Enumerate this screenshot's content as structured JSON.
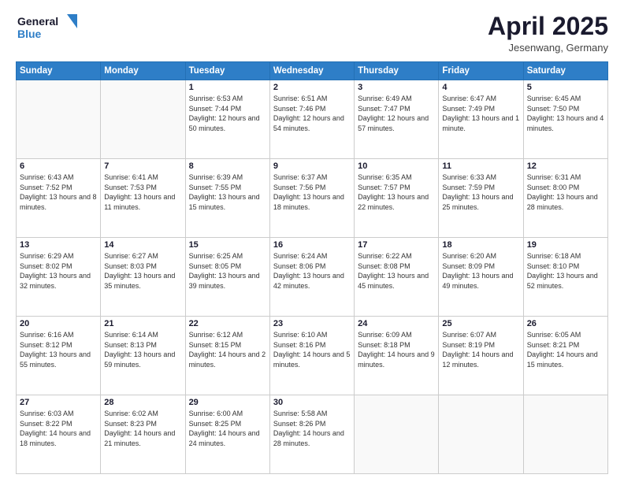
{
  "logo": {
    "line1": "General",
    "line2": "Blue"
  },
  "header": {
    "month": "April 2025",
    "location": "Jesenwang, Germany"
  },
  "weekdays": [
    "Sunday",
    "Monday",
    "Tuesday",
    "Wednesday",
    "Thursday",
    "Friday",
    "Saturday"
  ],
  "weeks": [
    [
      {
        "day": "",
        "info": ""
      },
      {
        "day": "",
        "info": ""
      },
      {
        "day": "1",
        "info": "Sunrise: 6:53 AM\nSunset: 7:44 PM\nDaylight: 12 hours and 50 minutes."
      },
      {
        "day": "2",
        "info": "Sunrise: 6:51 AM\nSunset: 7:46 PM\nDaylight: 12 hours and 54 minutes."
      },
      {
        "day": "3",
        "info": "Sunrise: 6:49 AM\nSunset: 7:47 PM\nDaylight: 12 hours and 57 minutes."
      },
      {
        "day": "4",
        "info": "Sunrise: 6:47 AM\nSunset: 7:49 PM\nDaylight: 13 hours and 1 minute."
      },
      {
        "day": "5",
        "info": "Sunrise: 6:45 AM\nSunset: 7:50 PM\nDaylight: 13 hours and 4 minutes."
      }
    ],
    [
      {
        "day": "6",
        "info": "Sunrise: 6:43 AM\nSunset: 7:52 PM\nDaylight: 13 hours and 8 minutes."
      },
      {
        "day": "7",
        "info": "Sunrise: 6:41 AM\nSunset: 7:53 PM\nDaylight: 13 hours and 11 minutes."
      },
      {
        "day": "8",
        "info": "Sunrise: 6:39 AM\nSunset: 7:55 PM\nDaylight: 13 hours and 15 minutes."
      },
      {
        "day": "9",
        "info": "Sunrise: 6:37 AM\nSunset: 7:56 PM\nDaylight: 13 hours and 18 minutes."
      },
      {
        "day": "10",
        "info": "Sunrise: 6:35 AM\nSunset: 7:57 PM\nDaylight: 13 hours and 22 minutes."
      },
      {
        "day": "11",
        "info": "Sunrise: 6:33 AM\nSunset: 7:59 PM\nDaylight: 13 hours and 25 minutes."
      },
      {
        "day": "12",
        "info": "Sunrise: 6:31 AM\nSunset: 8:00 PM\nDaylight: 13 hours and 28 minutes."
      }
    ],
    [
      {
        "day": "13",
        "info": "Sunrise: 6:29 AM\nSunset: 8:02 PM\nDaylight: 13 hours and 32 minutes."
      },
      {
        "day": "14",
        "info": "Sunrise: 6:27 AM\nSunset: 8:03 PM\nDaylight: 13 hours and 35 minutes."
      },
      {
        "day": "15",
        "info": "Sunrise: 6:25 AM\nSunset: 8:05 PM\nDaylight: 13 hours and 39 minutes."
      },
      {
        "day": "16",
        "info": "Sunrise: 6:24 AM\nSunset: 8:06 PM\nDaylight: 13 hours and 42 minutes."
      },
      {
        "day": "17",
        "info": "Sunrise: 6:22 AM\nSunset: 8:08 PM\nDaylight: 13 hours and 45 minutes."
      },
      {
        "day": "18",
        "info": "Sunrise: 6:20 AM\nSunset: 8:09 PM\nDaylight: 13 hours and 49 minutes."
      },
      {
        "day": "19",
        "info": "Sunrise: 6:18 AM\nSunset: 8:10 PM\nDaylight: 13 hours and 52 minutes."
      }
    ],
    [
      {
        "day": "20",
        "info": "Sunrise: 6:16 AM\nSunset: 8:12 PM\nDaylight: 13 hours and 55 minutes."
      },
      {
        "day": "21",
        "info": "Sunrise: 6:14 AM\nSunset: 8:13 PM\nDaylight: 13 hours and 59 minutes."
      },
      {
        "day": "22",
        "info": "Sunrise: 6:12 AM\nSunset: 8:15 PM\nDaylight: 14 hours and 2 minutes."
      },
      {
        "day": "23",
        "info": "Sunrise: 6:10 AM\nSunset: 8:16 PM\nDaylight: 14 hours and 5 minutes."
      },
      {
        "day": "24",
        "info": "Sunrise: 6:09 AM\nSunset: 8:18 PM\nDaylight: 14 hours and 9 minutes."
      },
      {
        "day": "25",
        "info": "Sunrise: 6:07 AM\nSunset: 8:19 PM\nDaylight: 14 hours and 12 minutes."
      },
      {
        "day": "26",
        "info": "Sunrise: 6:05 AM\nSunset: 8:21 PM\nDaylight: 14 hours and 15 minutes."
      }
    ],
    [
      {
        "day": "27",
        "info": "Sunrise: 6:03 AM\nSunset: 8:22 PM\nDaylight: 14 hours and 18 minutes."
      },
      {
        "day": "28",
        "info": "Sunrise: 6:02 AM\nSunset: 8:23 PM\nDaylight: 14 hours and 21 minutes."
      },
      {
        "day": "29",
        "info": "Sunrise: 6:00 AM\nSunset: 8:25 PM\nDaylight: 14 hours and 24 minutes."
      },
      {
        "day": "30",
        "info": "Sunrise: 5:58 AM\nSunset: 8:26 PM\nDaylight: 14 hours and 28 minutes."
      },
      {
        "day": "",
        "info": ""
      },
      {
        "day": "",
        "info": ""
      },
      {
        "day": "",
        "info": ""
      }
    ]
  ]
}
